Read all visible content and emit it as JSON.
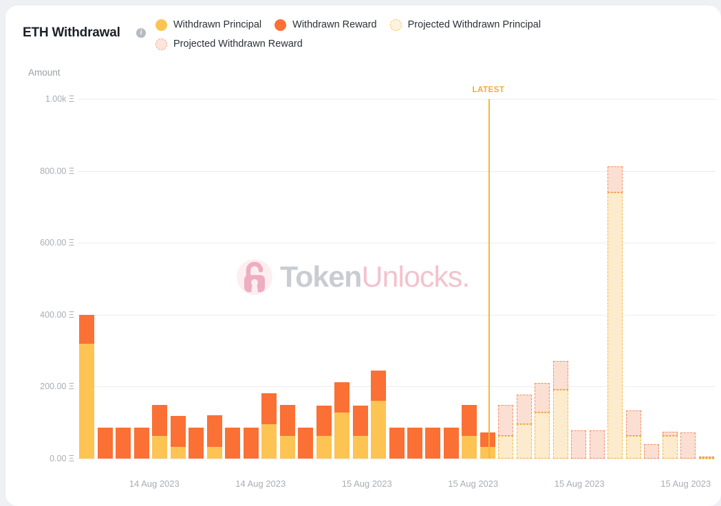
{
  "header": {
    "title": "ETH Withdrawal",
    "info_icon": "info-icon",
    "legend": [
      {
        "label": "Withdrawn Principal",
        "color": "#FDC453",
        "style": "solid"
      },
      {
        "label": "Withdrawn Reward",
        "color": "#FB7034",
        "style": "solid"
      },
      {
        "label": "Projected Withdrawn Principal",
        "color": "#FEF3DE",
        "style": "dashed"
      },
      {
        "label": "Projected Withdrawn Reward",
        "color": "#FCE6DC",
        "style": "dashed"
      }
    ]
  },
  "watermark": {
    "brand_primary": "Token",
    "brand_secondary": "Unlocks."
  },
  "annotation": {
    "latest_label": "LATEST"
  },
  "chart_data": {
    "type": "bar",
    "title": "ETH Withdrawal",
    "xlabel": "",
    "ylabel": "Amount",
    "unit": "Ξ",
    "stacked": true,
    "grid": true,
    "legend_position": "top-right",
    "ylim": [
      0,
      1000
    ],
    "yticks": [
      0,
      200,
      400,
      600,
      800,
      1000
    ],
    "ytick_labels": [
      "0.00 Ξ",
      "200.00 Ξ",
      "400.00 Ξ",
      "600.00 Ξ",
      "800.00 Ξ",
      "1.00k Ξ"
    ],
    "xtick_labels": [
      "14 Aug 2023",
      "14 Aug 2023",
      "15 Aug 2023",
      "15 Aug 2023",
      "15 Aug 2023",
      "15 Aug 2023"
    ],
    "latest_index": 21,
    "series": [
      {
        "name": "Withdrawn Principal",
        "color": "#FDC453",
        "style": "solid",
        "values": [
          320,
          0,
          0,
          0,
          64,
          32,
          0,
          32,
          0,
          0,
          96,
          64,
          0,
          64,
          128,
          64,
          160,
          0,
          0,
          0,
          0,
          64,
          32,
          null,
          null,
          null,
          null,
          null,
          null,
          null,
          null,
          null,
          null,
          null,
          null
        ]
      },
      {
        "name": "Withdrawn Reward",
        "color": "#FB7034",
        "style": "solid",
        "values": [
          80,
          86,
          86,
          86,
          86,
          86,
          86,
          88,
          86,
          86,
          86,
          86,
          86,
          84,
          84,
          84,
          84,
          86,
          86,
          86,
          86,
          86,
          40,
          null,
          null,
          null,
          null,
          null,
          null,
          null,
          null,
          null,
          null,
          null,
          null
        ]
      },
      {
        "name": "Projected Withdrawn Principal",
        "color": "#FDEBCD",
        "style": "dashed",
        "values": [
          null,
          null,
          null,
          null,
          null,
          null,
          null,
          null,
          null,
          null,
          null,
          null,
          null,
          null,
          null,
          null,
          null,
          null,
          null,
          null,
          null,
          null,
          null,
          64,
          96,
          128,
          192,
          0,
          0,
          740,
          64,
          0,
          64,
          0,
          2
        ]
      },
      {
        "name": "Projected Withdrawn Reward",
        "color": "#FBDFD3",
        "style": "dashed",
        "values": [
          null,
          null,
          null,
          null,
          null,
          null,
          null,
          null,
          null,
          null,
          null,
          null,
          null,
          null,
          null,
          null,
          null,
          null,
          null,
          null,
          null,
          null,
          null,
          86,
          82,
          82,
          80,
          78,
          78,
          72,
          70,
          40,
          10,
          72,
          4
        ]
      }
    ]
  }
}
